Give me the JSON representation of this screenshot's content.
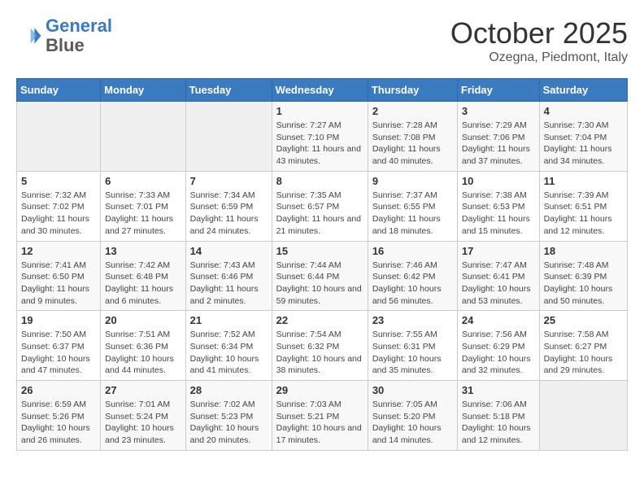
{
  "header": {
    "logo_line1": "General",
    "logo_line2": "Blue",
    "month": "October 2025",
    "location": "Ozegna, Piedmont, Italy"
  },
  "days_of_week": [
    "Sunday",
    "Monday",
    "Tuesday",
    "Wednesday",
    "Thursday",
    "Friday",
    "Saturday"
  ],
  "weeks": [
    [
      {
        "day": "",
        "info": ""
      },
      {
        "day": "",
        "info": ""
      },
      {
        "day": "",
        "info": ""
      },
      {
        "day": "1",
        "info": "Sunrise: 7:27 AM\nSunset: 7:10 PM\nDaylight: 11 hours and 43 minutes."
      },
      {
        "day": "2",
        "info": "Sunrise: 7:28 AM\nSunset: 7:08 PM\nDaylight: 11 hours and 40 minutes."
      },
      {
        "day": "3",
        "info": "Sunrise: 7:29 AM\nSunset: 7:06 PM\nDaylight: 11 hours and 37 minutes."
      },
      {
        "day": "4",
        "info": "Sunrise: 7:30 AM\nSunset: 7:04 PM\nDaylight: 11 hours and 34 minutes."
      }
    ],
    [
      {
        "day": "5",
        "info": "Sunrise: 7:32 AM\nSunset: 7:02 PM\nDaylight: 11 hours and 30 minutes."
      },
      {
        "day": "6",
        "info": "Sunrise: 7:33 AM\nSunset: 7:01 PM\nDaylight: 11 hours and 27 minutes."
      },
      {
        "day": "7",
        "info": "Sunrise: 7:34 AM\nSunset: 6:59 PM\nDaylight: 11 hours and 24 minutes."
      },
      {
        "day": "8",
        "info": "Sunrise: 7:35 AM\nSunset: 6:57 PM\nDaylight: 11 hours and 21 minutes."
      },
      {
        "day": "9",
        "info": "Sunrise: 7:37 AM\nSunset: 6:55 PM\nDaylight: 11 hours and 18 minutes."
      },
      {
        "day": "10",
        "info": "Sunrise: 7:38 AM\nSunset: 6:53 PM\nDaylight: 11 hours and 15 minutes."
      },
      {
        "day": "11",
        "info": "Sunrise: 7:39 AM\nSunset: 6:51 PM\nDaylight: 11 hours and 12 minutes."
      }
    ],
    [
      {
        "day": "12",
        "info": "Sunrise: 7:41 AM\nSunset: 6:50 PM\nDaylight: 11 hours and 9 minutes."
      },
      {
        "day": "13",
        "info": "Sunrise: 7:42 AM\nSunset: 6:48 PM\nDaylight: 11 hours and 6 minutes."
      },
      {
        "day": "14",
        "info": "Sunrise: 7:43 AM\nSunset: 6:46 PM\nDaylight: 11 hours and 2 minutes."
      },
      {
        "day": "15",
        "info": "Sunrise: 7:44 AM\nSunset: 6:44 PM\nDaylight: 10 hours and 59 minutes."
      },
      {
        "day": "16",
        "info": "Sunrise: 7:46 AM\nSunset: 6:42 PM\nDaylight: 10 hours and 56 minutes."
      },
      {
        "day": "17",
        "info": "Sunrise: 7:47 AM\nSunset: 6:41 PM\nDaylight: 10 hours and 53 minutes."
      },
      {
        "day": "18",
        "info": "Sunrise: 7:48 AM\nSunset: 6:39 PM\nDaylight: 10 hours and 50 minutes."
      }
    ],
    [
      {
        "day": "19",
        "info": "Sunrise: 7:50 AM\nSunset: 6:37 PM\nDaylight: 10 hours and 47 minutes."
      },
      {
        "day": "20",
        "info": "Sunrise: 7:51 AM\nSunset: 6:36 PM\nDaylight: 10 hours and 44 minutes."
      },
      {
        "day": "21",
        "info": "Sunrise: 7:52 AM\nSunset: 6:34 PM\nDaylight: 10 hours and 41 minutes."
      },
      {
        "day": "22",
        "info": "Sunrise: 7:54 AM\nSunset: 6:32 PM\nDaylight: 10 hours and 38 minutes."
      },
      {
        "day": "23",
        "info": "Sunrise: 7:55 AM\nSunset: 6:31 PM\nDaylight: 10 hours and 35 minutes."
      },
      {
        "day": "24",
        "info": "Sunrise: 7:56 AM\nSunset: 6:29 PM\nDaylight: 10 hours and 32 minutes."
      },
      {
        "day": "25",
        "info": "Sunrise: 7:58 AM\nSunset: 6:27 PM\nDaylight: 10 hours and 29 minutes."
      }
    ],
    [
      {
        "day": "26",
        "info": "Sunrise: 6:59 AM\nSunset: 5:26 PM\nDaylight: 10 hours and 26 minutes."
      },
      {
        "day": "27",
        "info": "Sunrise: 7:01 AM\nSunset: 5:24 PM\nDaylight: 10 hours and 23 minutes."
      },
      {
        "day": "28",
        "info": "Sunrise: 7:02 AM\nSunset: 5:23 PM\nDaylight: 10 hours and 20 minutes."
      },
      {
        "day": "29",
        "info": "Sunrise: 7:03 AM\nSunset: 5:21 PM\nDaylight: 10 hours and 17 minutes."
      },
      {
        "day": "30",
        "info": "Sunrise: 7:05 AM\nSunset: 5:20 PM\nDaylight: 10 hours and 14 minutes."
      },
      {
        "day": "31",
        "info": "Sunrise: 7:06 AM\nSunset: 5:18 PM\nDaylight: 10 hours and 12 minutes."
      },
      {
        "day": "",
        "info": ""
      }
    ]
  ]
}
